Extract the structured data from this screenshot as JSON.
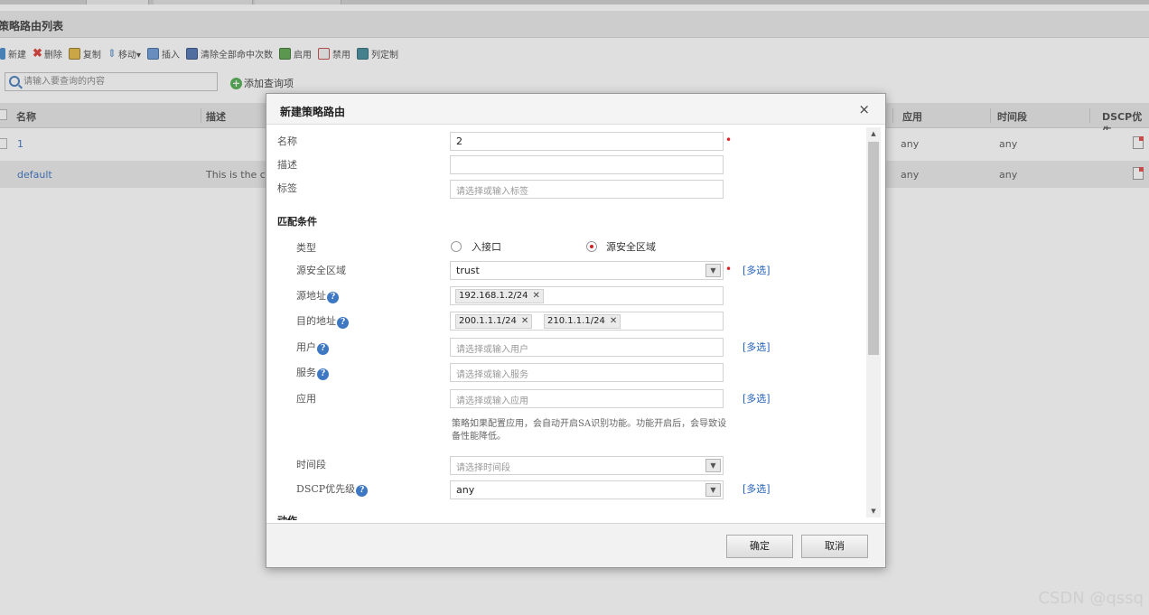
{
  "page": {
    "title": "策略路由列表"
  },
  "toolbar": {
    "new": "新建",
    "delete": "删除",
    "copy": "复制",
    "move": "移动▾",
    "insert": "插入",
    "clear_hits": "清除全部命中次数",
    "enable": "启用",
    "disable": "禁用",
    "columns": "列定制"
  },
  "search": {
    "placeholder": "请输入要查询的内容",
    "add_query": "添加查询项"
  },
  "grid": {
    "headers": {
      "name": "名称",
      "desc": "描述",
      "app": "应用",
      "time": "时间段",
      "dscp": "DSCP优先"
    },
    "rows": [
      {
        "name": "1",
        "desc": "",
        "app": "any",
        "time": "any"
      },
      {
        "name": "default",
        "desc": "This is the c",
        "app": "any",
        "time": "any"
      }
    ]
  },
  "dialog": {
    "title": "新建策略路由",
    "close": "×",
    "name_label": "名称",
    "name_value": "2",
    "desc_label": "描述",
    "desc_value": "",
    "tag_label": "标签",
    "tag_placeholder": "请选择或输入标签",
    "section_match": "匹配条件",
    "type_label": "类型",
    "type_opt1": "入接口",
    "type_opt2": "源安全区域",
    "src_zone_label": "源安全区域",
    "src_zone_value": "trust",
    "more": "[多选]",
    "src_addr_label": "源地址",
    "src_addr_tags": [
      "192.168.1.2/24"
    ],
    "dst_addr_label": "目的地址",
    "dst_addr_tags": [
      "200.1.1.1/24",
      "210.1.1.1/24"
    ],
    "user_label": "用户",
    "user_placeholder": "请选择或输入用户",
    "service_label": "服务",
    "service_placeholder": "请选择或输入服务",
    "app_label": "应用",
    "app_placeholder": "请选择或输入应用",
    "app_note": "策略如果配置应用，会自动开启SA识别功能。功能开启后，会导致设备性能降低。",
    "time_label": "时间段",
    "time_placeholder": "请选择时间段",
    "dscp_label": "DSCP优先级",
    "dscp_value": "any",
    "section_action": "动作",
    "ok": "确定",
    "cancel": "取消"
  },
  "watermark": "CSDN @qssq"
}
